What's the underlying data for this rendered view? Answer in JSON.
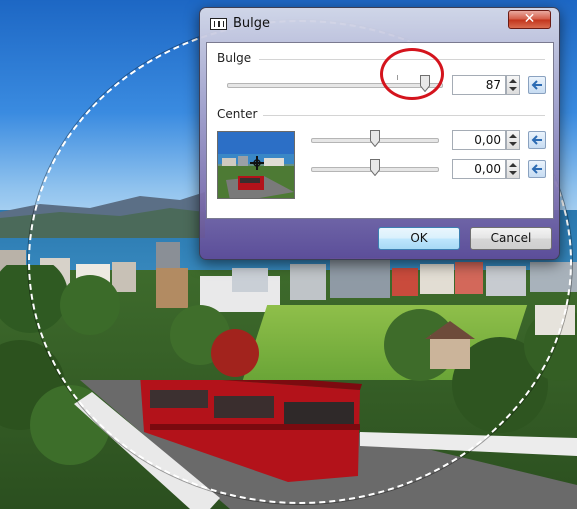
{
  "dialog": {
    "title": "Bulge",
    "close_symbol": "✕",
    "bulge": {
      "label": "Bulge",
      "value": "87"
    },
    "center": {
      "label": "Center",
      "x_value": "0,00",
      "y_value": "0,00"
    },
    "ok_label": "OK",
    "cancel_label": "Cancel"
  },
  "icons": {
    "app": "bulge-effect-icon",
    "close": "close-icon",
    "reset": "reset-arrow-icon",
    "spin": "spin-arrows-icon",
    "crosshair": "crosshair-icon"
  },
  "colors": {
    "highlight": "#d4141d",
    "close_button": "#c2341c",
    "default_button_border": "#3c7fb1"
  }
}
